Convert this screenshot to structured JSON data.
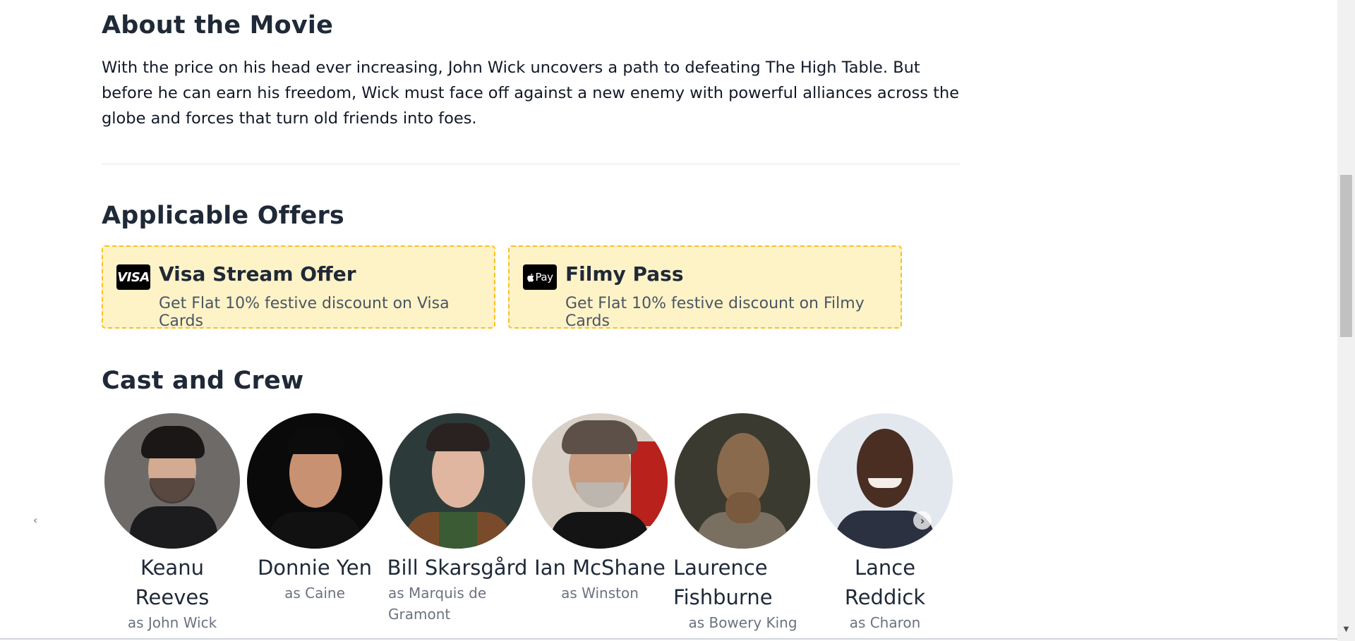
{
  "about": {
    "title": "About the Movie",
    "text": "With the price on his head ever increasing, John Wick uncovers a path to defeating The High Table. But before he can earn his freedom, Wick must face off against a new enemy with powerful alliances across the globe and forces that turn old friends into foes."
  },
  "offers": {
    "title": "Applicable Offers",
    "items": [
      {
        "logo": "VISA",
        "title": "Visa Stream Offer",
        "description": "Get Flat 10% festive discount on Visa Cards",
        "icon": "visa-icon"
      },
      {
        "logo": " Pay",
        "title": "Filmy Pass",
        "description": "Get Flat 10% festive discount on Filmy Cards",
        "icon": "apple-pay-icon"
      }
    ]
  },
  "cast": {
    "title": "Cast and Crew",
    "members": [
      {
        "name": "Keanu Reeves",
        "role": "as John Wick"
      },
      {
        "name": "Donnie Yen",
        "role": "as Caine"
      },
      {
        "name": "Bill Skarsgård",
        "role": "as Marquis de Gramont"
      },
      {
        "name": "Ian McShane",
        "role": "as Winston"
      },
      {
        "name": "Laurence Fishburne",
        "role": "as Bowery King"
      },
      {
        "name": "Lance Reddick",
        "role": "as Charon"
      }
    ]
  },
  "carousel": {
    "prev_icon": "‹",
    "next_icon": "›"
  },
  "colors": {
    "offer_bg": "#fef3c7",
    "offer_border": "#fbbf24",
    "heading": "#1f2937",
    "muted": "#6b7280"
  }
}
